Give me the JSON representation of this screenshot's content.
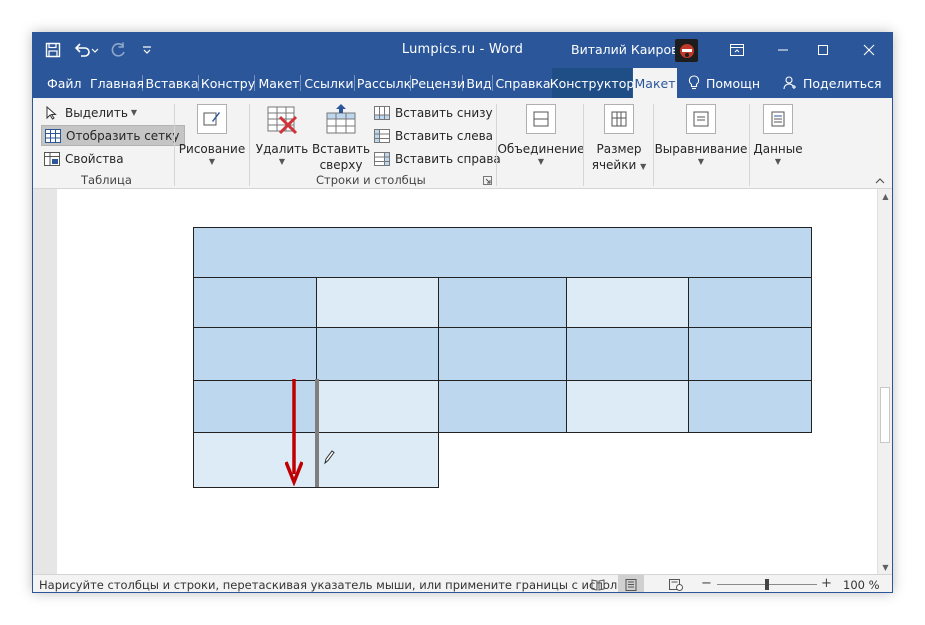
{
  "window": {
    "title": "Lumpics.ru  -  Word",
    "user_name": "Виталий Каиров"
  },
  "tabs": [
    {
      "label": "Файл"
    },
    {
      "label": "Главная"
    },
    {
      "label": "Вставка"
    },
    {
      "label": "Констру"
    },
    {
      "label": "Макет"
    },
    {
      "label": "Ссылки"
    },
    {
      "label": "Рассылк"
    },
    {
      "label": "Рецензи"
    },
    {
      "label": "Вид"
    },
    {
      "label": "Справка"
    },
    {
      "label": "Конструктор"
    },
    {
      "label": "Макет"
    },
    {
      "label": "Помощн"
    },
    {
      "label": "Поделиться"
    }
  ],
  "ribbon": {
    "table_group": {
      "select": "Выделить",
      "view_gridlines": "Отобразить сетку",
      "properties": "Свойства",
      "label": "Таблица"
    },
    "draw": "Рисование",
    "rows_cols": {
      "delete": "Удалить",
      "insert_above_1": "Вставить",
      "insert_above_2": "сверху",
      "insert_below": "Вставить снизу",
      "insert_left": "Вставить слева",
      "insert_right": "Вставить справа",
      "label": "Строки и столбцы"
    },
    "merge": "Объединение",
    "cell_size_1": "Размер",
    "cell_size_2": "ячейки",
    "alignment": "Выравнивание",
    "data": "Данные"
  },
  "statusbar": {
    "text": "Нарисуйте столбцы и строки, перетаскивая указатель мыши, или примените границы с исполь...",
    "zoom": "100 %",
    "zoom_percent": 100
  },
  "table": {
    "fill_colors": {
      "dark": "#bdd7ee",
      "light": "#ddebf7"
    },
    "rows": [
      [
        "dark"
      ],
      [
        "dark",
        "light",
        "dark",
        "light",
        "dark"
      ],
      [
        "dark",
        "dark",
        "dark",
        "dark",
        "dark"
      ],
      [
        "dark",
        "light",
        "dark",
        "light",
        "dark"
      ],
      [
        "light",
        "light"
      ]
    ]
  },
  "colors": {
    "word_blue": "#2b579a",
    "arrow_red": "#c00000"
  }
}
